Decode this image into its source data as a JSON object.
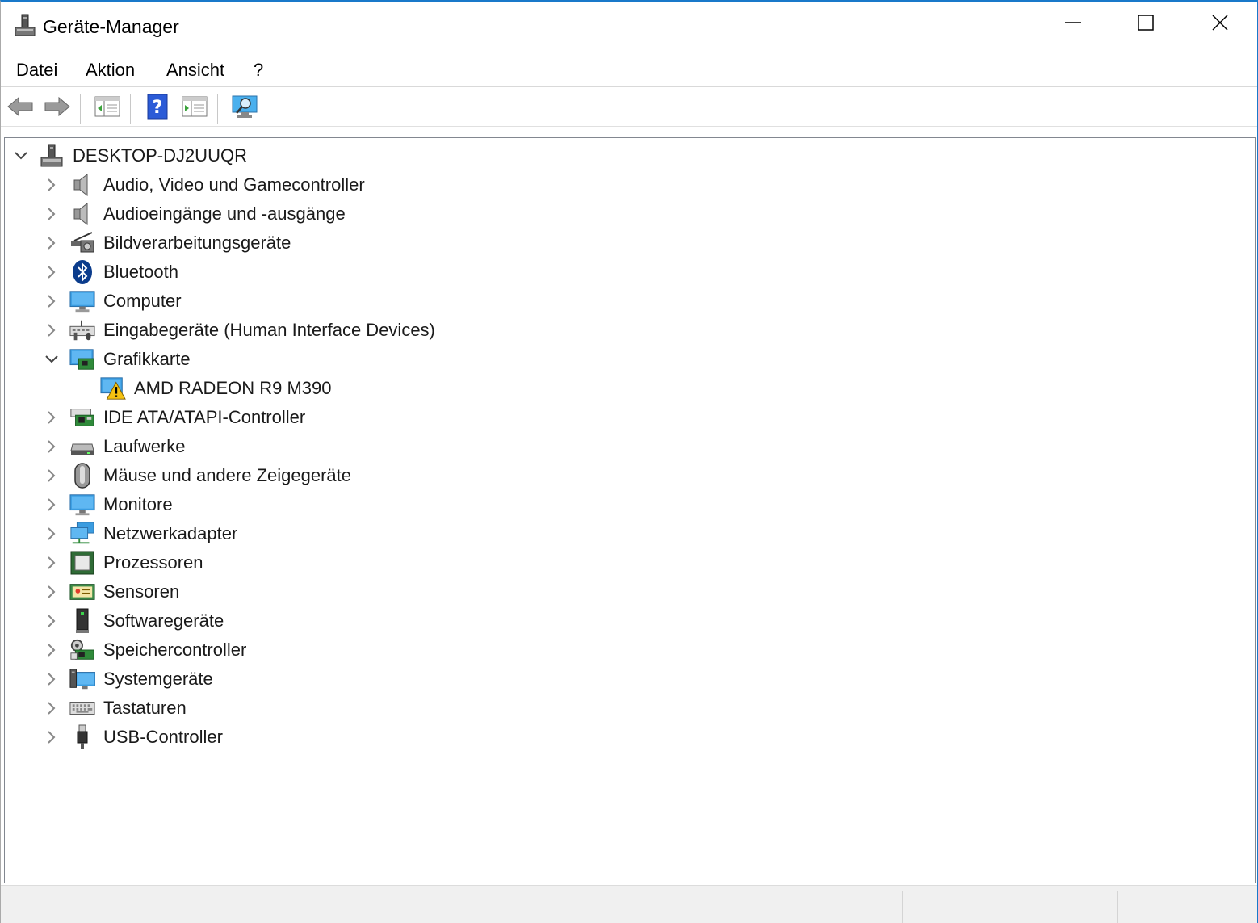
{
  "window": {
    "title": "Geräte-Manager"
  },
  "menu": {
    "items": [
      "Datei",
      "Aktion",
      "Ansicht",
      "?"
    ]
  },
  "toolbar": {
    "buttons": [
      "back-arrow-icon",
      "forward-arrow-icon",
      "show-hide-console-tree-icon",
      "help-icon",
      "properties-panel-icon",
      "scan-hardware-icon"
    ]
  },
  "tree": {
    "root": {
      "label": "DESKTOP-DJ2UUQR",
      "expanded": true,
      "icon": "computer-tower-icon"
    },
    "categories": [
      {
        "label": "Audio, Video und Gamecontroller",
        "icon": "speaker-icon",
        "expanded": false
      },
      {
        "label": "Audioeingänge und -ausgänge",
        "icon": "speaker-icon",
        "expanded": false
      },
      {
        "label": "Bildverarbeitungsgeräte",
        "icon": "camera-icon",
        "expanded": false
      },
      {
        "label": "Bluetooth",
        "icon": "bluetooth-icon",
        "expanded": false
      },
      {
        "label": "Computer",
        "icon": "monitor-icon",
        "expanded": false
      },
      {
        "label": "Eingabegeräte (Human Interface Devices)",
        "icon": "hid-icon",
        "expanded": false
      },
      {
        "label": "Grafikkarte",
        "icon": "display-adapter-icon",
        "expanded": true,
        "children": [
          {
            "label": "AMD RADEON R9 M390",
            "icon": "display-adapter-warning-icon"
          }
        ]
      },
      {
        "label": "IDE ATA/ATAPI-Controller",
        "icon": "ide-controller-icon",
        "expanded": false
      },
      {
        "label": "Laufwerke",
        "icon": "disk-drive-icon",
        "expanded": false
      },
      {
        "label": "Mäuse und andere Zeigegeräte",
        "icon": "mouse-icon",
        "expanded": false
      },
      {
        "label": "Monitore",
        "icon": "monitor-icon",
        "expanded": false
      },
      {
        "label": "Netzwerkadapter",
        "icon": "network-adapter-icon",
        "expanded": false
      },
      {
        "label": "Prozessoren",
        "icon": "processor-icon",
        "expanded": false
      },
      {
        "label": "Sensoren",
        "icon": "sensor-icon",
        "expanded": false
      },
      {
        "label": "Softwaregeräte",
        "icon": "software-device-icon",
        "expanded": false
      },
      {
        "label": "Speichercontroller",
        "icon": "storage-controller-icon",
        "expanded": false
      },
      {
        "label": "Systemgeräte",
        "icon": "system-devices-icon",
        "expanded": false
      },
      {
        "label": "Tastaturen",
        "icon": "keyboard-icon",
        "expanded": false
      },
      {
        "label": "USB-Controller",
        "icon": "usb-icon",
        "expanded": false
      }
    ]
  },
  "colors": {
    "accent": "#1979ca",
    "warning": "#f5c211",
    "monitor_blue": "#3a9ce0"
  }
}
